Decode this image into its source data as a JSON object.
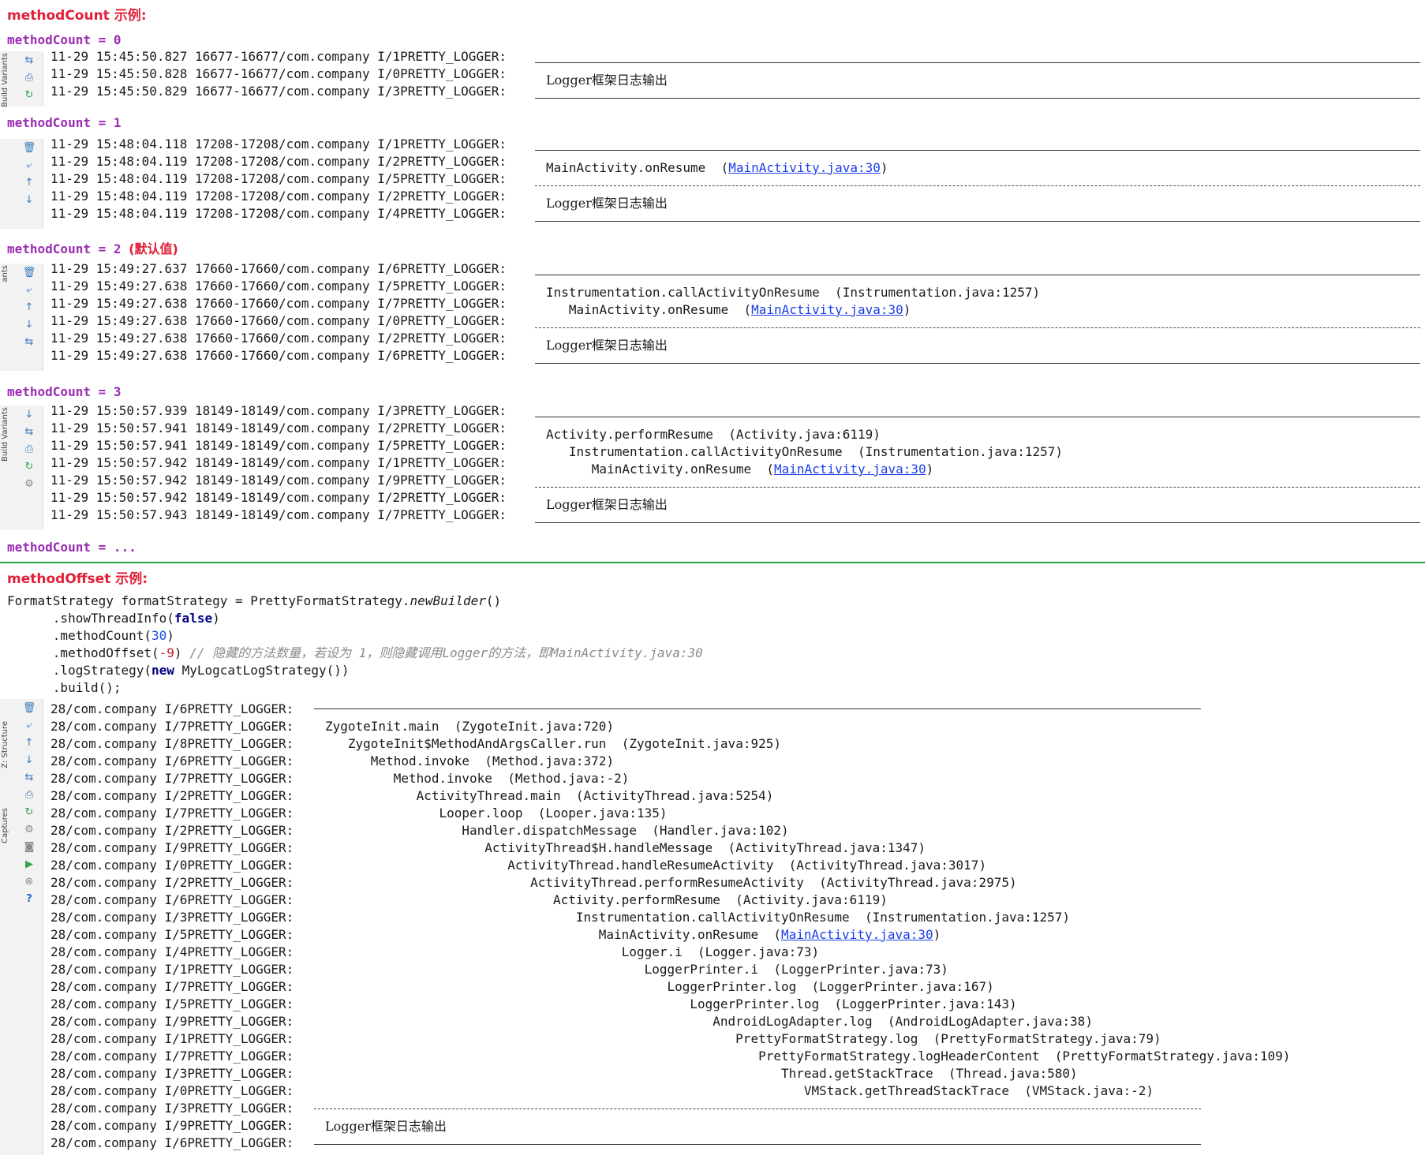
{
  "method_count": {
    "title": "methodCount 示例:",
    "examples": [
      {
        "label": "methodCount = 0",
        "default_note": "",
        "tab_label": "Build Variants",
        "icons": [
          "wrap-icon",
          "print-icon",
          "restart-icon"
        ],
        "log_lines": [
          "11-29 15:45:50.827 16677-16677/com.company I/1PRETTY_LOGGER:",
          "11-29 15:45:50.828 16677-16677/com.company I/0PRETTY_LOGGER:",
          "11-29 15:45:50.829 16677-16677/com.company I/3PRETTY_LOGGER:"
        ],
        "stack": [],
        "message": "Logger框架日志输出"
      },
      {
        "label": "methodCount = 1",
        "default_note": "",
        "tab_label": "",
        "icons": [
          "trash-icon",
          "soft-wrap-icon",
          "arrow-up-icon",
          "arrow-down-icon"
        ],
        "log_lines": [
          "11-29 15:48:04.118 17208-17208/com.company I/1PRETTY_LOGGER:",
          "11-29 15:48:04.119 17208-17208/com.company I/2PRETTY_LOGGER:",
          "11-29 15:48:04.119 17208-17208/com.company I/5PRETTY_LOGGER:",
          "11-29 15:48:04.119 17208-17208/com.company I/2PRETTY_LOGGER:",
          "11-29 15:48:04.119 17208-17208/com.company I/4PRETTY_LOGGER:"
        ],
        "stack": [
          {
            "method": "MainActivity.onResume",
            "src": "MainActivity.java:30",
            "link": true
          }
        ],
        "message": "Logger框架日志输出"
      },
      {
        "label": "methodCount = 2",
        "default_note": "(默认值)",
        "tab_label": "ants",
        "icons": [
          "trash-icon",
          "soft-wrap-icon",
          "arrow-up-icon",
          "arrow-down-icon",
          "wrap-icon"
        ],
        "log_lines": [
          "11-29 15:49:27.637 17660-17660/com.company I/6PRETTY_LOGGER:",
          "11-29 15:49:27.638 17660-17660/com.company I/5PRETTY_LOGGER:",
          "11-29 15:49:27.638 17660-17660/com.company I/7PRETTY_LOGGER:",
          "11-29 15:49:27.638 17660-17660/com.company I/0PRETTY_LOGGER:",
          "11-29 15:49:27.638 17660-17660/com.company I/2PRETTY_LOGGER:",
          "11-29 15:49:27.638 17660-17660/com.company I/6PRETTY_LOGGER:"
        ],
        "stack": [
          {
            "method": "Instrumentation.callActivityOnResume",
            "src": "Instrumentation.java:1257",
            "link": false
          },
          {
            "method": "MainActivity.onResume",
            "src": "MainActivity.java:30",
            "link": true
          }
        ],
        "message": "Logger框架日志输出"
      },
      {
        "label": "methodCount = 3",
        "default_note": "",
        "tab_label": "Build Variants",
        "icons": [
          "arrow-down-icon",
          "wrap-icon",
          "print-icon",
          "restart-icon",
          "gear-icon"
        ],
        "log_lines": [
          "11-29 15:50:57.939 18149-18149/com.company I/3PRETTY_LOGGER:",
          "11-29 15:50:57.941 18149-18149/com.company I/2PRETTY_LOGGER:",
          "11-29 15:50:57.941 18149-18149/com.company I/5PRETTY_LOGGER:",
          "11-29 15:50:57.942 18149-18149/com.company I/1PRETTY_LOGGER:",
          "11-29 15:50:57.942 18149-18149/com.company I/9PRETTY_LOGGER:",
          "11-29 15:50:57.942 18149-18149/com.company I/2PRETTY_LOGGER:",
          "11-29 15:50:57.943 18149-18149/com.company I/7PRETTY_LOGGER:"
        ],
        "stack": [
          {
            "method": "Activity.performResume",
            "src": "Activity.java:6119",
            "link": false
          },
          {
            "method": "Instrumentation.callActivityOnResume",
            "src": "Instrumentation.java:1257",
            "link": false
          },
          {
            "method": "MainActivity.onResume",
            "src": "MainActivity.java:30",
            "link": true
          }
        ],
        "message": "Logger框架日志输出"
      }
    ],
    "more_label": "methodCount = ..."
  },
  "method_offset": {
    "title": "methodOffset 示例:",
    "code": {
      "line1_decl": "FormatStrategy formatStrategy = PrettyFormatStrategy.",
      "line1_call": "newBuilder",
      "line1_end": "()",
      "line2_pre": "      .showThreadInfo(",
      "line2_kw": "false",
      "line2_end": ")",
      "line3_pre": "      .methodCount(",
      "line3_num": "30",
      "line3_end": ")",
      "line4_pre": "      .methodOffset(",
      "line4_num": "-9",
      "line4_end": ") ",
      "line4_comment": "// 隐藏的方法数量，若设为 1，则隐藏调用Logger的方法，即MainActivity.java:30",
      "line5_pre": "      .logStrategy(",
      "line5_kw": "new",
      "line5_end": " MyLogcatLogStrategy())",
      "line6": "      .build();"
    },
    "tab_labels": [
      "Z: Structure",
      "Captures"
    ],
    "icons": [
      "trash-icon",
      "soft-wrap-icon",
      "arrow-up-icon",
      "arrow-down-icon",
      "wrap-icon",
      "print-icon",
      "restart-icon",
      "gear-icon",
      "camera-icon",
      "play-icon",
      "close-circle-icon",
      "help-icon"
    ],
    "log_lines": [
      "28/com.company I/6PRETTY_LOGGER:",
      "28/com.company I/7PRETTY_LOGGER:",
      "28/com.company I/8PRETTY_LOGGER:",
      "28/com.company I/6PRETTY_LOGGER:",
      "28/com.company I/7PRETTY_LOGGER:",
      "28/com.company I/2PRETTY_LOGGER:",
      "28/com.company I/7PRETTY_LOGGER:",
      "28/com.company I/2PRETTY_LOGGER:",
      "28/com.company I/9PRETTY_LOGGER:",
      "28/com.company I/0PRETTY_LOGGER:",
      "28/com.company I/2PRETTY_LOGGER:",
      "28/com.company I/6PRETTY_LOGGER:",
      "28/com.company I/3PRETTY_LOGGER:",
      "28/com.company I/5PRETTY_LOGGER:",
      "28/com.company I/4PRETTY_LOGGER:",
      "28/com.company I/1PRETTY_LOGGER:",
      "28/com.company I/7PRETTY_LOGGER:",
      "28/com.company I/5PRETTY_LOGGER:",
      "28/com.company I/9PRETTY_LOGGER:",
      "28/com.company I/1PRETTY_LOGGER:",
      "28/com.company I/7PRETTY_LOGGER:",
      "28/com.company I/3PRETTY_LOGGER:",
      "28/com.company I/0PRETTY_LOGGER:",
      "28/com.company I/3PRETTY_LOGGER:",
      "28/com.company I/9PRETTY_LOGGER:",
      "28/com.company I/6PRETTY_LOGGER:"
    ],
    "stack": [
      {
        "method": "ZygoteInit.main",
        "src": "ZygoteInit.java:720",
        "link": false
      },
      {
        "method": "ZygoteInit$MethodAndArgsCaller.run",
        "src": "ZygoteInit.java:925",
        "link": false
      },
      {
        "method": "Method.invoke",
        "src": "Method.java:372",
        "link": false
      },
      {
        "method": "Method.invoke",
        "src": "Method.java:-2",
        "link": false
      },
      {
        "method": "ActivityThread.main",
        "src": "ActivityThread.java:5254",
        "link": false
      },
      {
        "method": "Looper.loop",
        "src": "Looper.java:135",
        "link": false
      },
      {
        "method": "Handler.dispatchMessage",
        "src": "Handler.java:102",
        "link": false
      },
      {
        "method": "ActivityThread$H.handleMessage",
        "src": "ActivityThread.java:1347",
        "link": false
      },
      {
        "method": "ActivityThread.handleResumeActivity",
        "src": "ActivityThread.java:3017",
        "link": false
      },
      {
        "method": "ActivityThread.performResumeActivity",
        "src": "ActivityThread.java:2975",
        "link": false
      },
      {
        "method": "Activity.performResume",
        "src": "Activity.java:6119",
        "link": false
      },
      {
        "method": "Instrumentation.callActivityOnResume",
        "src": "Instrumentation.java:1257",
        "link": false
      },
      {
        "method": "MainActivity.onResume",
        "src": "MainActivity.java:30",
        "link": true
      },
      {
        "method": "Logger.i",
        "src": "Logger.java:73",
        "link": false
      },
      {
        "method": "LoggerPrinter.i",
        "src": "LoggerPrinter.java:73",
        "link": false
      },
      {
        "method": "LoggerPrinter.log",
        "src": "LoggerPrinter.java:167",
        "link": false
      },
      {
        "method": "LoggerPrinter.log",
        "src": "LoggerPrinter.java:143",
        "link": false
      },
      {
        "method": "AndroidLogAdapter.log",
        "src": "AndroidLogAdapter.java:38",
        "link": false
      },
      {
        "method": "PrettyFormatStrategy.log",
        "src": "PrettyFormatStrategy.java:79",
        "link": false
      },
      {
        "method": "PrettyFormatStrategy.logHeaderContent",
        "src": "PrettyFormatStrategy.java:109",
        "link": false
      },
      {
        "method": "Thread.getStackTrace",
        "src": "Thread.java:580",
        "link": false
      },
      {
        "method": "VMStack.getThreadStackTrace",
        "src": "VMStack.java:-2",
        "link": false
      }
    ],
    "message": "Logger框架日志输出"
  },
  "colors": {
    "section_title": "#e0203a",
    "method_count_label": "#9b2bb3",
    "link": "#1a3de8",
    "divider": "#26a042"
  }
}
